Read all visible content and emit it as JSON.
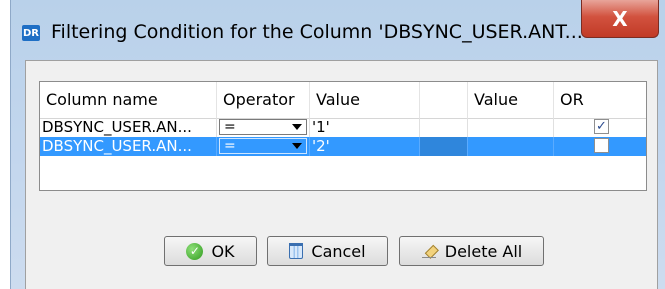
{
  "window": {
    "icon_text": "DR",
    "title": "Filtering Condition for the Column 'DBSYNC_USER.ANT...",
    "close_glyph": "X"
  },
  "grid": {
    "headers": [
      "Column name",
      "Operator",
      "Value",
      "",
      "Value",
      "OR"
    ],
    "rows": [
      {
        "column": "DBSYNC_USER.AN...",
        "operator": "=",
        "value": "'1'",
        "value2": "",
        "or_checked": true,
        "selected": false
      },
      {
        "column": "DBSYNC_USER.AN...",
        "operator": "=",
        "value": "'2'",
        "value2": "",
        "or_checked": false,
        "selected": true
      }
    ]
  },
  "buttons": {
    "ok": "OK",
    "cancel": "Cancel",
    "delete_all": "Delete All"
  },
  "icons": {
    "app": "dr-app-icon",
    "ok": "check-circle-icon",
    "cancel": "trash-icon",
    "delete_all": "eraser-icon",
    "dropdown": "chevron-down-icon"
  },
  "colors": {
    "selection": "#3399ff",
    "close_button": "#c13a26",
    "title_bar": "#b9d1ea"
  }
}
